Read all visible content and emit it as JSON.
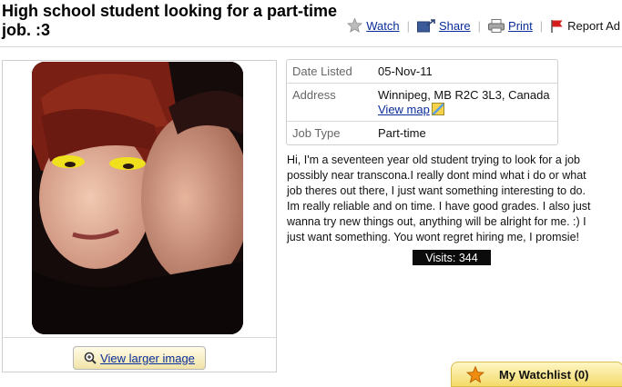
{
  "listing": {
    "title": "High school student looking for a part-time job. :3"
  },
  "actions": {
    "watch_label": "Watch",
    "share_label": "Share",
    "print_label": "Print",
    "report_label": "Report Ad"
  },
  "details": {
    "date_label": "Date Listed",
    "date_value": "05-Nov-11",
    "address_label": "Address",
    "address_value": "Winnipeg, MB R2C 3L3, Canada",
    "view_map_label": "View map",
    "job_type_label": "Job Type",
    "job_type_value": "Part-time"
  },
  "description": "Hi, I'm a seventeen year old student trying to look for a job possibly near transcona.I really dont mind what i do or what job theres out there, I just want something interesting to do. Im really reliable and on time. I have good grades. I also just wanna try new things out, anything will be alright for me. :) I just want something. You wont regret hiring me, I promsie!",
  "visits_label": "Visits: 344",
  "photo": {
    "view_larger_label": "View larger image"
  },
  "watchlist": {
    "label": "My Watchlist (0)"
  },
  "colors": {
    "link": "#0a2c9a",
    "watchlist_bg": "#f3dc6b",
    "visits_bg": "#0b0b0b"
  },
  "icons": [
    "star-icon",
    "share-icon",
    "print-icon",
    "flag-icon",
    "map-icon",
    "magnifier-icon"
  ]
}
